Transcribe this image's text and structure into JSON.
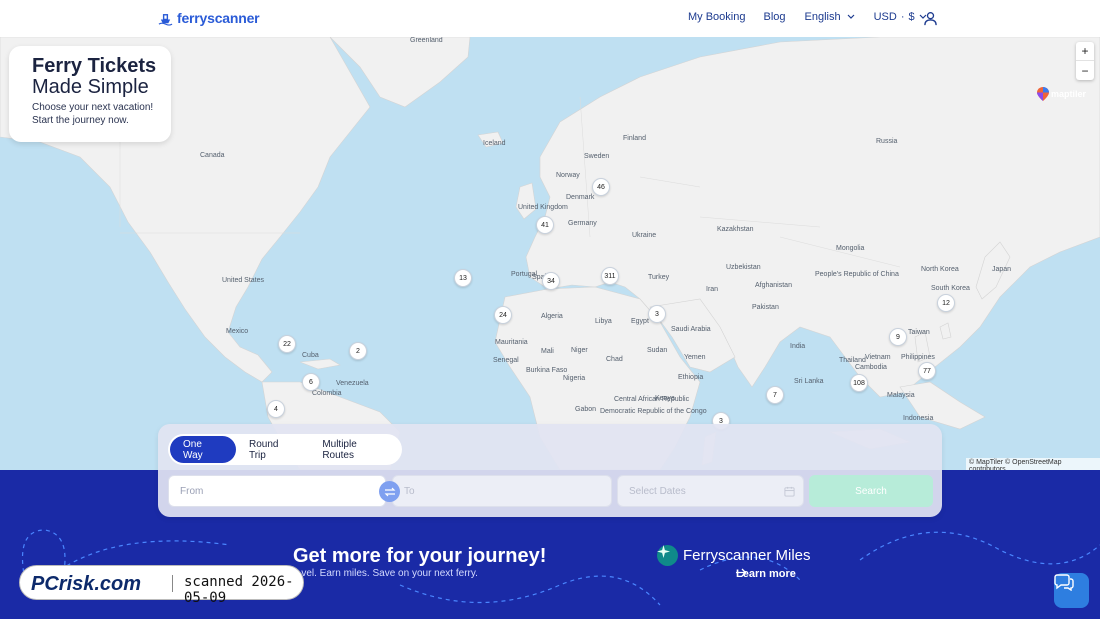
{
  "header": {
    "logo_text": "ferryscanner",
    "nav": {
      "my_booking": "My Booking",
      "blog": "Blog",
      "language": "English",
      "currency": "USD",
      "currency_sep": "·",
      "currency_symbol": "$"
    },
    "icons": {
      "user": "user-icon",
      "chevron": "chevron-down-icon"
    }
  },
  "hero": {
    "title_line1": "Ferry Tickets",
    "title_line2": "Made Simple",
    "subtitle_line1": "Choose your next vacation!",
    "subtitle_line2": "Start the journey now."
  },
  "map": {
    "zoom_in": "+",
    "zoom_out": "−",
    "brand": "maptiler",
    "attribution": "© MapTiler © OpenStreetMap contributors",
    "places": [
      "Greenland",
      "Iceland",
      "Sweden",
      "Finland",
      "Russia",
      "Norway",
      "Denmark",
      "United Kingdom",
      "Germany",
      "Ukraine",
      "Kazakhstan",
      "Mongolia",
      "Uzbekistan",
      "Turkey",
      "Portugal",
      "Spain",
      "Algeria",
      "Libya",
      "Egypt",
      "Iran",
      "Afghanistan",
      "Pakistan",
      "People's Republic of China",
      "North Korea",
      "South Korea",
      "Japan",
      "Saudi Arabia",
      "Yemen",
      "India",
      "Taiwan",
      "Thailand",
      "Vietnam",
      "Philippines",
      "Cambodia",
      "Malaysia",
      "Indonesia",
      "Sri Lanka",
      "Mauritania",
      "Mali",
      "Niger",
      "Sudan",
      "Chad",
      "Nigeria",
      "Senegal",
      "Burkina Faso",
      "Ethiopia",
      "Central African Republic",
      "Kenya",
      "Gabon",
      "Democratic Republic of the Congo",
      "Canada",
      "United States",
      "Mexico",
      "Cuba",
      "Colombia",
      "Venezuela"
    ],
    "markers": [
      "46",
      "41",
      "311",
      "34",
      "13",
      "24",
      "3",
      "22",
      "2",
      "6",
      "4",
      "12",
      "9",
      "77",
      "108",
      "7",
      "3"
    ]
  },
  "search": {
    "tabs": [
      "One Way",
      "Round Trip",
      "Multiple Routes"
    ],
    "active_tab": "One Way",
    "from_placeholder": "From",
    "to_placeholder": "To",
    "dates_placeholder": "Select Dates",
    "search_label": "Search"
  },
  "promo": {
    "title": "Get more for your journey!",
    "subtitle": "...vel. Earn miles. Save on your next ferry.",
    "miles_title": "Ferryscanner Miles",
    "learn_more": "Learn more"
  },
  "watermark": {
    "brand": "PCrisk.com",
    "text": "scanned 2026-05-09"
  },
  "colors": {
    "primary": "#1f3bc0",
    "band": "#1a2aa6",
    "sea": "#bfe0f2",
    "land": "#f1f1f1",
    "search_button": "#b7ecd9",
    "chat": "#2e7ee0"
  }
}
